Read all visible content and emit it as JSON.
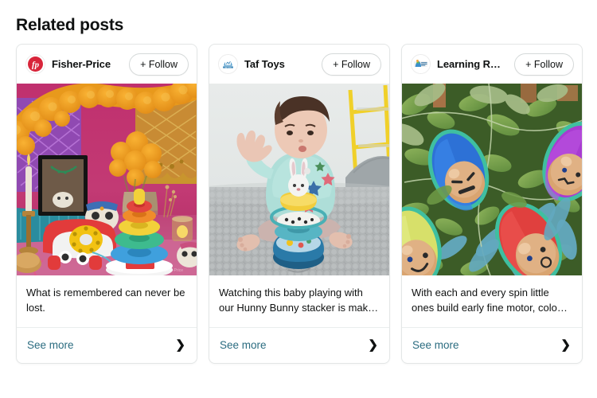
{
  "header": {
    "title": "Related posts"
  },
  "cards": [
    {
      "brand": "Fisher-Price",
      "avatar_icon": "fisher-price-logo-icon",
      "follow_label": "+ Follow",
      "image_alt": "day-of-the-dead-altar-with-fisher-price-toys",
      "caption": "What is remembered can never be lost.",
      "see_more_label": "See more",
      "chevron_icon": "chevron-right-icon"
    },
    {
      "brand": "Taf Toys",
      "avatar_icon": "taf-toys-logo-icon",
      "follow_label": "+ Follow",
      "image_alt": "baby-playing-with-hunny-bunny-stacker-on-grey-rug",
      "caption": "Watching this baby playing with our Hunny Bunny stacker is mak…",
      "see_more_label": "See more",
      "chevron_icon": "chevron-right-icon"
    },
    {
      "brand": "Learning R…",
      "avatar_icon": "learning-resources-logo-icon",
      "follow_label": "+ Follow",
      "image_alt": "avocado-shaped-character-toys-on-green-foliage",
      "caption": "With each and every spin little ones build early fine motor, colo…",
      "see_more_label": "See more",
      "chevron_icon": "chevron-right-icon"
    }
  ],
  "colors": {
    "link_teal": "#2b6c80",
    "text_primary": "#0f1111",
    "card_border": "#e3e6e6",
    "button_border": "#d5d9d9",
    "fisher_price_red": "#d8253a",
    "taf_toys_blue": "#4a90c4",
    "page_background": "#ffffff"
  }
}
